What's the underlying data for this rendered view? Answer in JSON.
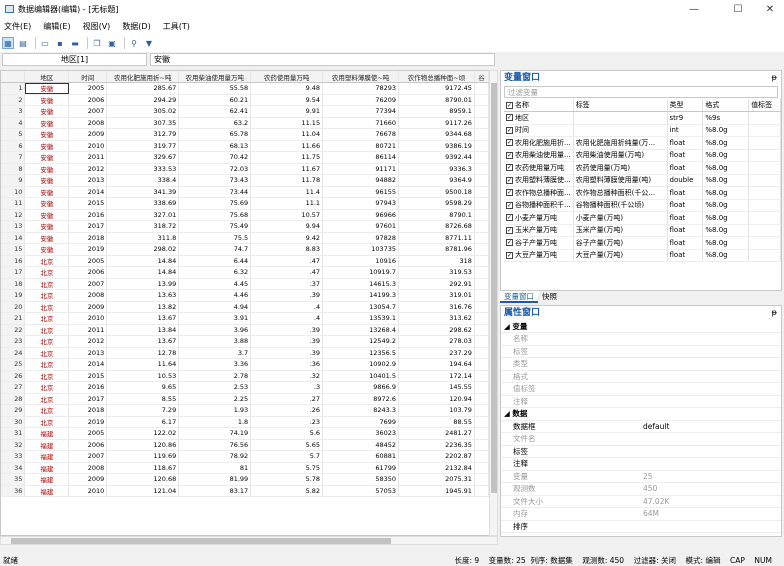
{
  "window": {
    "title": "数据编辑器(编辑) - [无标题]",
    "min": "—",
    "max": "☐",
    "close": "✕"
  },
  "menu": [
    "文件(E)",
    "编辑(E)",
    "视图(V)",
    "数据(D)",
    "工具(T)"
  ],
  "toolbar": [
    "grid-view-icon",
    "table-dropdown-icon",
    "open-folder-icon",
    "save-icon",
    "print-icon",
    "copy-icon",
    "paste-icon",
    "search-icon",
    "filter-icon"
  ],
  "cmd": {
    "varname": "地区[1]",
    "value": "安徽"
  },
  "grid": {
    "columns": [
      "地区",
      "时间",
      "农用化肥施用折~吨",
      "农用柴油使用量万吨",
      "农药使用量万吨",
      "农用塑料薄膜使~吨",
      "农作物总播种面~顷",
      "谷"
    ],
    "rows": [
      [
        "1",
        "安徽",
        "2005",
        "285.67",
        "55.58",
        "9.48",
        "78293",
        "9172.45"
      ],
      [
        "2",
        "安徽",
        "2006",
        "294.29",
        "60.21",
        "9.54",
        "76209",
        "8790.01"
      ],
      [
        "3",
        "安徽",
        "2007",
        "305.02",
        "62.41",
        "9.91",
        "77394",
        "8959.1"
      ],
      [
        "4",
        "安徽",
        "2008",
        "307.35",
        "63.2",
        "11.15",
        "71660",
        "9117.26"
      ],
      [
        "5",
        "安徽",
        "2009",
        "312.79",
        "65.78",
        "11.04",
        "76678",
        "9344.68"
      ],
      [
        "6",
        "安徽",
        "2010",
        "319.77",
        "68.13",
        "11.66",
        "80721",
        "9386.19"
      ],
      [
        "7",
        "安徽",
        "2011",
        "329.67",
        "70.42",
        "11.75",
        "86114",
        "9392.44"
      ],
      [
        "8",
        "安徽",
        "2012",
        "333.53",
        "72.03",
        "11.67",
        "91171",
        "9336.3"
      ],
      [
        "9",
        "安徽",
        "2013",
        "338.4",
        "73.43",
        "11.78",
        "94882",
        "9364.9"
      ],
      [
        "10",
        "安徽",
        "2014",
        "341.39",
        "73.44",
        "11.4",
        "96155",
        "9500.18"
      ],
      [
        "11",
        "安徽",
        "2015",
        "338.69",
        "75.69",
        "11.1",
        "97943",
        "9598.29"
      ],
      [
        "12",
        "安徽",
        "2016",
        "327.01",
        "75.68",
        "10.57",
        "96966",
        "8790.1"
      ],
      [
        "13",
        "安徽",
        "2017",
        "318.72",
        "75.49",
        "9.94",
        "97601",
        "8726.68"
      ],
      [
        "14",
        "安徽",
        "2018",
        "311.8",
        "75.5",
        "9.42",
        "97828",
        "8771.11"
      ],
      [
        "15",
        "安徽",
        "2019",
        "298.02",
        "74.7",
        "8.83",
        "103735",
        "8781.96"
      ],
      [
        "16",
        "北京",
        "2005",
        "14.84",
        "6.44",
        ".47",
        "10916",
        "318"
      ],
      [
        "17",
        "北京",
        "2006",
        "14.84",
        "6.32",
        ".47",
        "10919.7",
        "319.53"
      ],
      [
        "18",
        "北京",
        "2007",
        "13.99",
        "4.45",
        ".37",
        "14615.3",
        "292.91"
      ],
      [
        "19",
        "北京",
        "2008",
        "13.63",
        "4.46",
        ".39",
        "14199.3",
        "319.01"
      ],
      [
        "20",
        "北京",
        "2009",
        "13.82",
        "4.94",
        ".4",
        "13054.7",
        "316.76"
      ],
      [
        "21",
        "北京",
        "2010",
        "13.67",
        "3.91",
        ".4",
        "13539.1",
        "313.62"
      ],
      [
        "22",
        "北京",
        "2011",
        "13.84",
        "3.96",
        ".39",
        "13268.4",
        "298.62"
      ],
      [
        "23",
        "北京",
        "2012",
        "13.67",
        "3.88",
        ".39",
        "12549.2",
        "278.03"
      ],
      [
        "24",
        "北京",
        "2013",
        "12.78",
        "3.7",
        ".39",
        "12356.5",
        "237.29"
      ],
      [
        "25",
        "北京",
        "2014",
        "11.64",
        "3.36",
        ".36",
        "10902.9",
        "194.64"
      ],
      [
        "26",
        "北京",
        "2015",
        "10.53",
        "2.78",
        ".32",
        "10401.5",
        "172.14"
      ],
      [
        "27",
        "北京",
        "2016",
        "9.65",
        "2.53",
        ".3",
        "9866.9",
        "145.55"
      ],
      [
        "28",
        "北京",
        "2017",
        "8.55",
        "2.25",
        ".27",
        "8972.6",
        "120.94"
      ],
      [
        "29",
        "北京",
        "2018",
        "7.29",
        "1.93",
        ".26",
        "8243.3",
        "103.79"
      ],
      [
        "30",
        "北京",
        "2019",
        "6.17",
        "1.8",
        ".23",
        "7699",
        "88.55"
      ],
      [
        "31",
        "福建",
        "2005",
        "122.02",
        "74.19",
        "5.6",
        "36023",
        "2481.27"
      ],
      [
        "32",
        "福建",
        "2006",
        "120.86",
        "76.56",
        "5.65",
        "48452",
        "2236.35"
      ],
      [
        "33",
        "福建",
        "2007",
        "119.69",
        "78.92",
        "5.7",
        "60881",
        "2202.87"
      ],
      [
        "34",
        "福建",
        "2008",
        "118.67",
        "81",
        "5.75",
        "61799",
        "2132.84"
      ],
      [
        "35",
        "福建",
        "2009",
        "120.68",
        "81.99",
        "5.78",
        "58350",
        "2075.31"
      ],
      [
        "36",
        "福建",
        "2010",
        "121.04",
        "83.17",
        "5.82",
        "57053",
        "1945.91"
      ]
    ]
  },
  "varpanel": {
    "title": "变量窗口",
    "pin": "ᵽ",
    "filter_placeholder": "过滤变量",
    "headers": [
      "名称",
      "标签",
      "类型",
      "格式",
      "值标签"
    ],
    "rows": [
      [
        "地区",
        "",
        "str9",
        "%9s"
      ],
      [
        "时间",
        "",
        "int",
        "%8.0g"
      ],
      [
        "农用化肥施用折...",
        "农用化肥施用折纯量(万...",
        "float",
        "%8.0g"
      ],
      [
        "农用柴油使用量...",
        "农用柴油使用量(万吨)",
        "float",
        "%8.0g"
      ],
      [
        "农药使用量万吨",
        "农药使用量(万吨)",
        "float",
        "%8.0g"
      ],
      [
        "农用塑料薄膜使...",
        "农用塑料薄膜使用量(吨)",
        "double",
        "%8.0g"
      ],
      [
        "农作物总播种面...",
        "农作物总播种面积(千公...",
        "float",
        "%8.0g"
      ],
      [
        "谷物播种面积千...",
        "谷物播种面积(千公顷)",
        "float",
        "%8.0g"
      ],
      [
        "小麦产量万吨",
        "小麦产量(万吨)",
        "float",
        "%8.0g"
      ],
      [
        "玉米产量万吨",
        "玉米产量(万吨)",
        "float",
        "%8.0g"
      ],
      [
        "谷子产量万吨",
        "谷子产量(万吨)",
        "float",
        "%8.0g"
      ],
      [
        "大豆产量万吨",
        "大豆产量(万吨)",
        "float",
        "%8.0g"
      ]
    ],
    "tabs": [
      "变量窗口",
      "快照"
    ]
  },
  "propanel": {
    "title": "属性窗口",
    "sec_var": "变量",
    "var_rows": [
      [
        "名称",
        ""
      ],
      [
        "标签",
        ""
      ],
      [
        "类型",
        ""
      ],
      [
        "格式",
        ""
      ],
      [
        "值标签",
        ""
      ],
      [
        "注释",
        ""
      ]
    ],
    "sec_data": "数据",
    "data_rows": [
      [
        "数据框",
        "default"
      ],
      [
        "文件名",
        ""
      ],
      [
        "标签",
        ""
      ],
      [
        "注释",
        ""
      ],
      [
        "变量",
        "25"
      ],
      [
        "观测数",
        "450"
      ],
      [
        "文件大小",
        "47.02K"
      ],
      [
        "内存",
        "64M"
      ],
      [
        "排序",
        ""
      ]
    ]
  },
  "status": {
    "left": "就绪",
    "right": "长度: 9    变量数: 25  列序: 数据集    观测数: 450    过滤器: 关闭    模式: 编辑    CAP    NUM"
  }
}
